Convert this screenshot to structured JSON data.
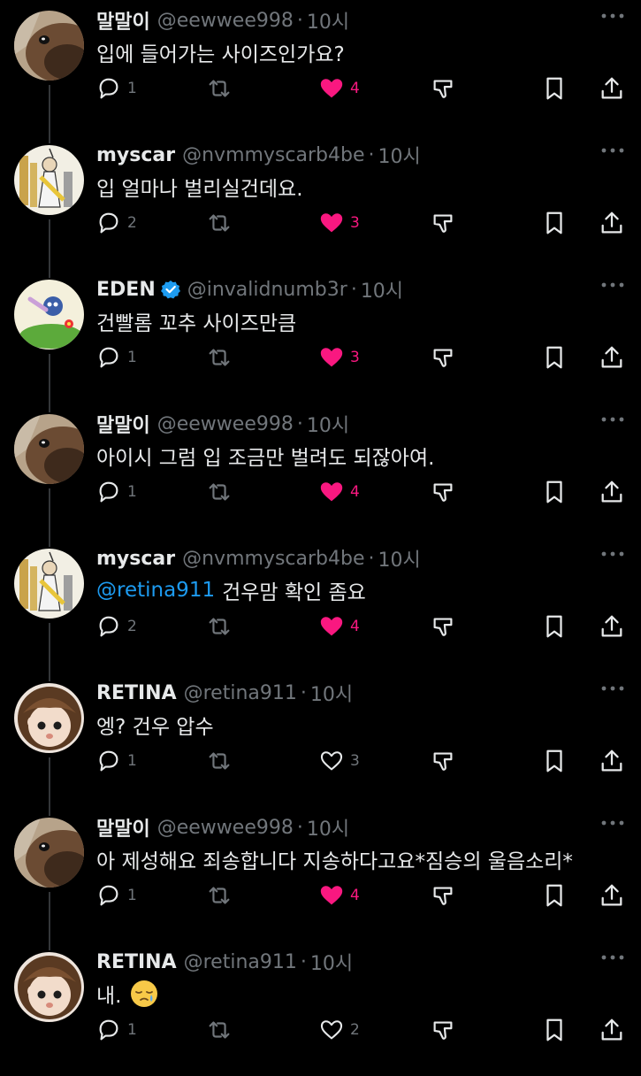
{
  "icons": {
    "reply": "reply-icon",
    "retweet": "retweet-icon",
    "like": "heart-icon",
    "views": "views-icon",
    "bookmark": "bookmark-icon",
    "share": "share-icon",
    "more": "more-icon",
    "verified": "verified-badge-icon"
  },
  "colors": {
    "background": "#000000",
    "text": "#e7e9ea",
    "secondary": "#71767b",
    "like_active": "#f91880",
    "mention": "#1d9bf0",
    "verified": "#1d9bf0"
  },
  "tweets": [
    {
      "name": "말말이",
      "handle": "@eewwee998",
      "dot": "·",
      "time": "10시",
      "text": "입에 들어가는 사이즈인가요?",
      "mention": "",
      "replies": "1",
      "likes": "4",
      "liked": true,
      "verified": false,
      "avatar": "horse"
    },
    {
      "name": "myscar",
      "handle": "@nvmmyscarb4be",
      "dot": "·",
      "time": "10시",
      "text": "입 얼마나 벌리실건데요.",
      "mention": "",
      "replies": "2",
      "likes": "3",
      "liked": true,
      "verified": false,
      "avatar": "drawing"
    },
    {
      "name": "EDEN",
      "handle": "@invalidnumb3r",
      "dot": "·",
      "time": "10시",
      "text": "건빨롬 꼬추 사이즈만큼",
      "mention": "",
      "replies": "1",
      "likes": "3",
      "liked": true,
      "verified": true,
      "avatar": "cartoon"
    },
    {
      "name": "말말이",
      "handle": "@eewwee998",
      "dot": "·",
      "time": "10시",
      "text": "아이시 그럼 입 조금만 벌려도 되잖아여.",
      "mention": "",
      "replies": "1",
      "likes": "4",
      "liked": true,
      "verified": false,
      "avatar": "horse"
    },
    {
      "name": "myscar",
      "handle": "@nvmmyscarb4be",
      "dot": "·",
      "time": "10시",
      "text": "건우맘 확인 좀요",
      "mention": "@retina911",
      "replies": "2",
      "likes": "4",
      "liked": true,
      "verified": false,
      "avatar": "drawing"
    },
    {
      "name": "RETINA",
      "handle": "@retina911",
      "dot": "·",
      "time": "10시",
      "text": "엥? 건우 압수",
      "mention": "",
      "replies": "1",
      "likes": "3",
      "liked": false,
      "verified": false,
      "avatar": "doll"
    },
    {
      "name": "말말이",
      "handle": "@eewwee998",
      "dot": "·",
      "time": "10시",
      "text": "아 제성해요 죄송합니다 지송하다고요*짐승의 울음소리*",
      "mention": "",
      "replies": "1",
      "likes": "4",
      "liked": true,
      "verified": false,
      "avatar": "horse"
    },
    {
      "name": "RETINA",
      "handle": "@retina911",
      "dot": "·",
      "time": "10시",
      "text": "내.",
      "mention": "",
      "emoji": "sleepy-face-emoji",
      "replies": "1",
      "likes": "2",
      "liked": false,
      "verified": false,
      "avatar": "doll"
    }
  ]
}
